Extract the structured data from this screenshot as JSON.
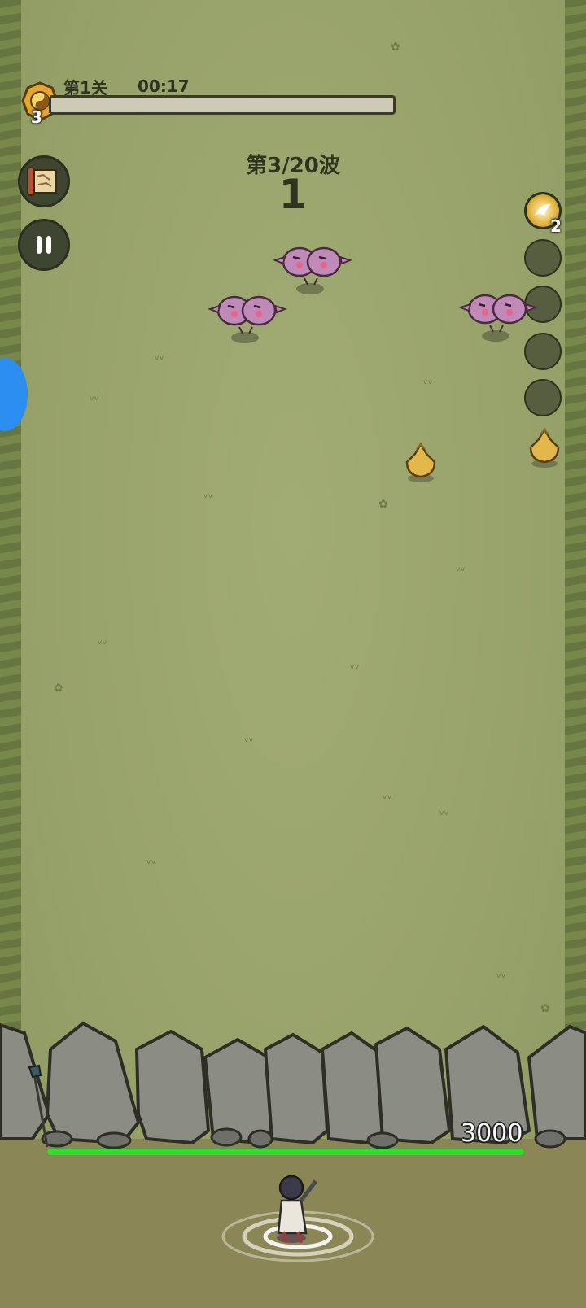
{
  "hud": {
    "level_badge": "3",
    "stage": "第1关",
    "timer": "00:17",
    "stage_progress": 0.0
  },
  "wave": {
    "label": "第3/20波",
    "countdown": "1"
  },
  "skills": {
    "active_count": "2",
    "slots": [
      "bird-skill-icon",
      "empty",
      "empty",
      "empty",
      "empty"
    ]
  },
  "wall": {
    "hp": "3000",
    "hp_fraction": 1.0
  },
  "colors": {
    "field": "#9aa56e",
    "hp_green": "#2fe02a",
    "enemy_purple": "#c08ab8",
    "chick_yellow": "#e3b84a",
    "blue_tab": "#2b8df0"
  }
}
